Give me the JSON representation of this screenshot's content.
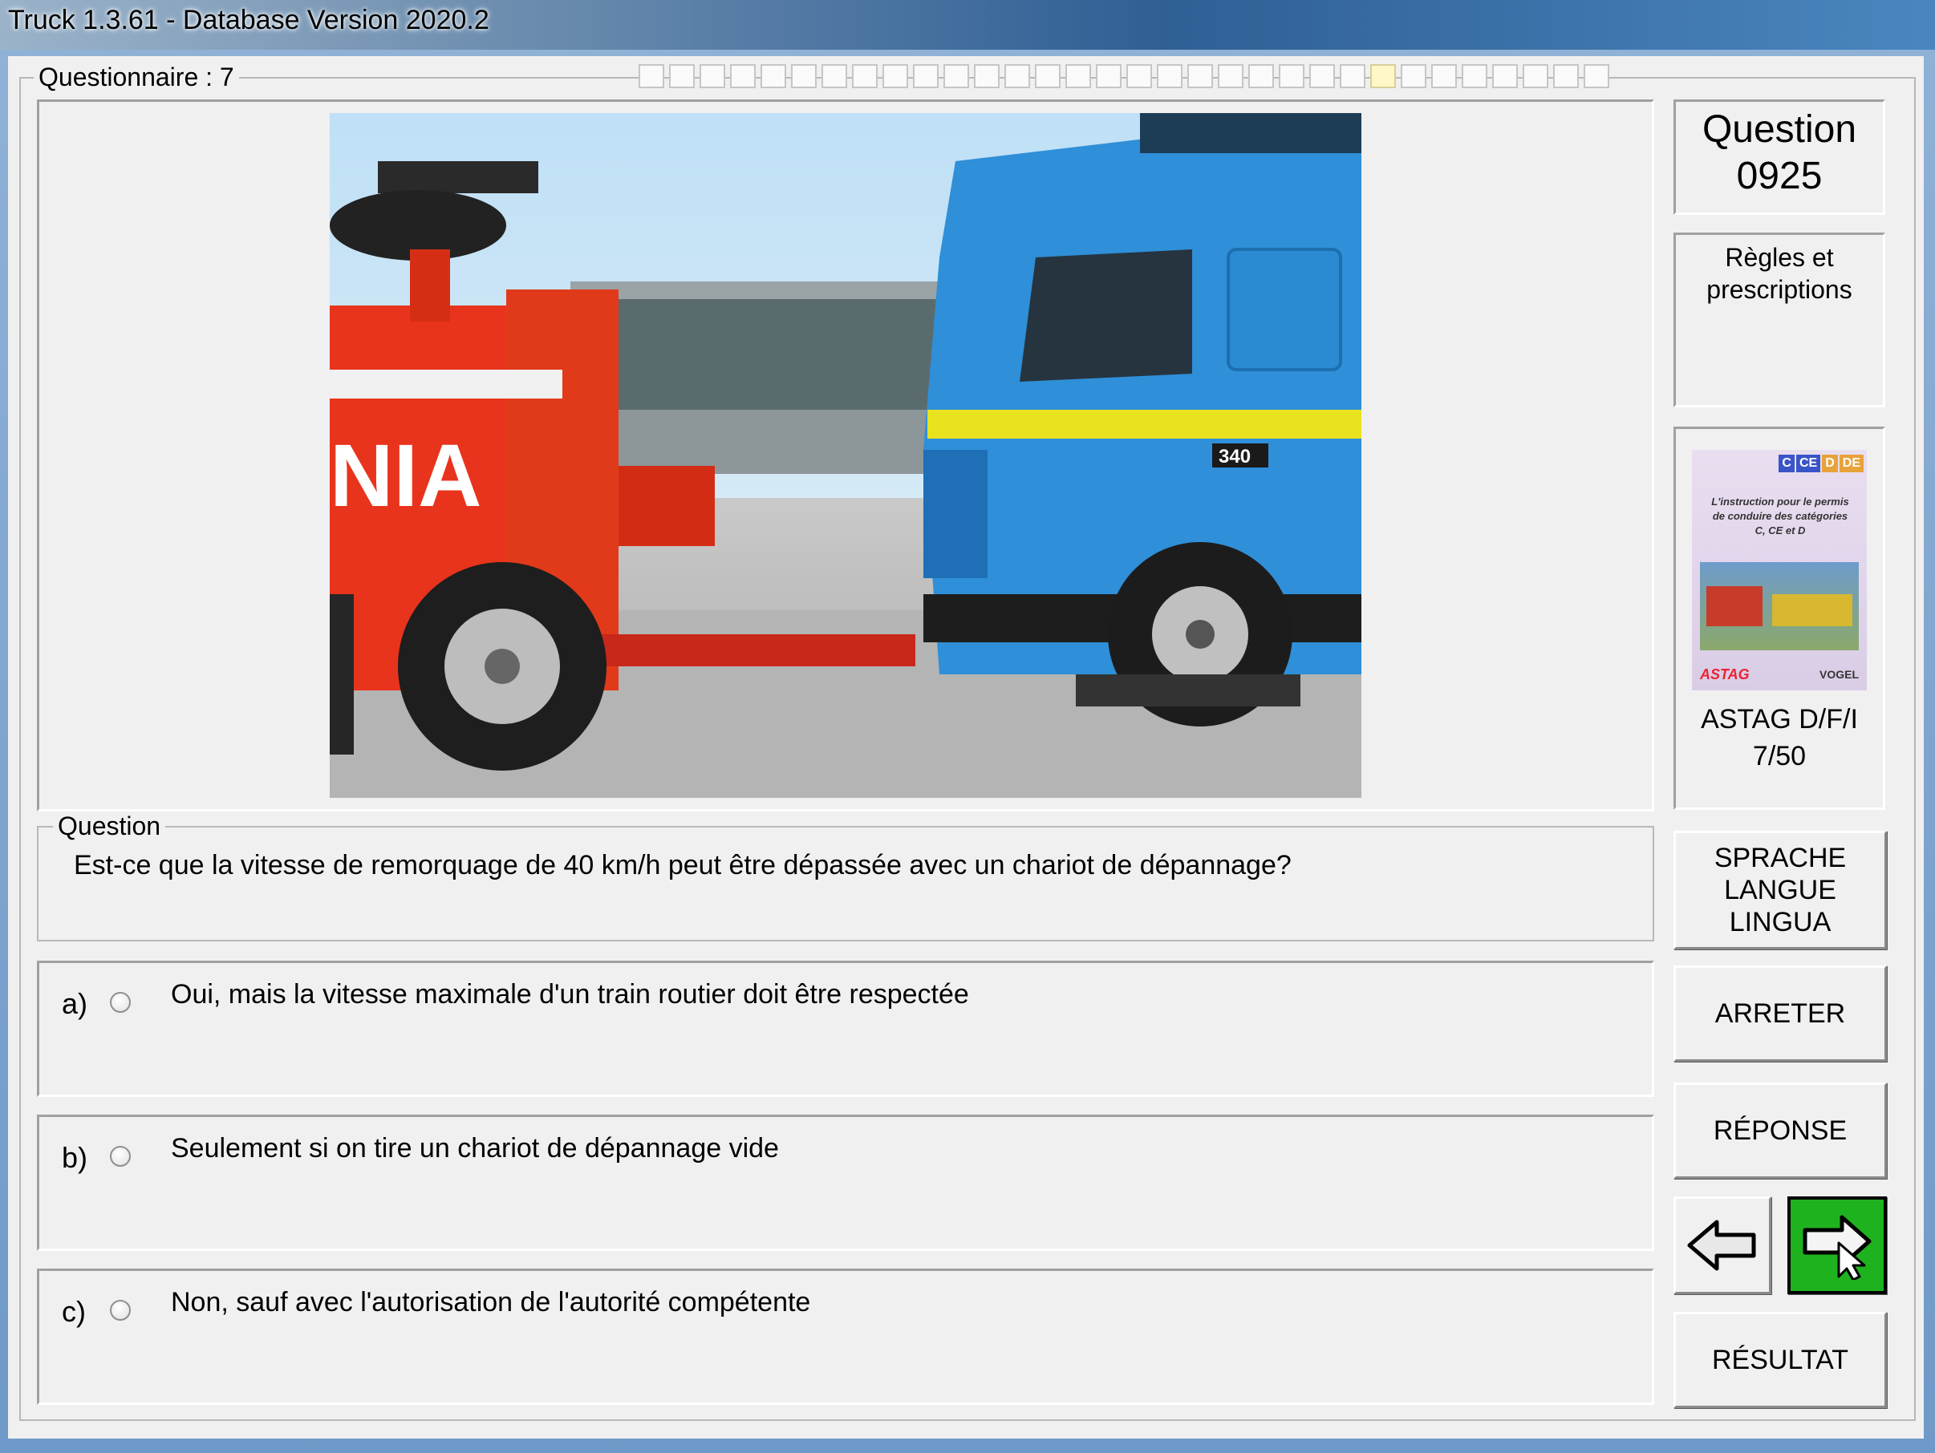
{
  "window": {
    "title": "Truck 1.3.61 - Database Version 2020.2"
  },
  "questionnaire": {
    "label": "Questionnaire : 7",
    "progress_total": 32,
    "progress_current": 25
  },
  "question_panel": {
    "label": "Question",
    "number": "0925",
    "category": "Règles et prescriptions"
  },
  "book": {
    "badges": [
      "C",
      "CE",
      "D",
      "DE"
    ],
    "subtitle": "L'instruction pour le permis de conduire des catégories C, CE et D",
    "logo_left": "ASTAG",
    "logo_right": "VOGEL",
    "source": "ASTAG D/F/I",
    "page": "7/50"
  },
  "question": {
    "legend": "Question",
    "text": "Est-ce que la vitesse de remorquage de 40 km/h peut être dépassée avec un chariot de dépannage?"
  },
  "answers": [
    {
      "letter": "a)",
      "text": "Oui, mais la vitesse maximale d'un train routier doit être respectée"
    },
    {
      "letter": "b)",
      "text": "Seulement si on tire un chariot de dépannage vide"
    },
    {
      "letter": "c)",
      "text": "Non, sauf avec l'autorisation de l'autorité compétente"
    }
  ],
  "buttons": {
    "language": [
      "SPRACHE",
      "LANGUE",
      "LINGUA"
    ],
    "stop": "ARRETER",
    "answer": "RÉPONSE",
    "result": "RÉSULTAT"
  },
  "photo": {
    "tow_truck_text": "NIA",
    "truck_badge": "340"
  },
  "colors": {
    "tow_truck": "#e8341c",
    "truck_blue": "#2f8fd8",
    "truck_stripe": "#e9e21e",
    "next_button": "#1fb21f"
  }
}
